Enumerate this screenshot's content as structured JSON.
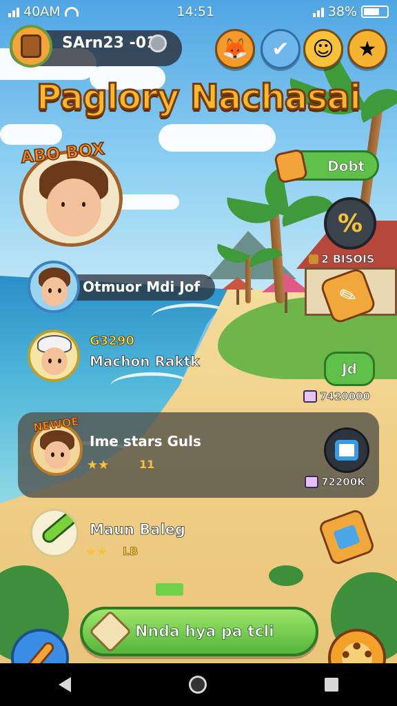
{
  "status_bar": {
    "left_text": "40AM",
    "time": "14:51",
    "battery": "38%"
  },
  "top_hud": {
    "profile_code": "SArn23 -01",
    "buttons": [
      "fox-icon",
      "check-icon",
      "face-icon",
      "star-icon"
    ]
  },
  "title": "Paglory Nachasai",
  "hero": {
    "badge": "ABO BOX"
  },
  "side_panel": {
    "dobt_label": "Dobt",
    "percent_label": "%",
    "rating_note": "2 BISOIS",
    "jd_label": "Jd",
    "coins_1": "7420000",
    "coins_2": "72200K"
  },
  "players": [
    {
      "name": "Otmuor Mdi Jof"
    },
    {
      "code": "G3290",
      "name": "Machon Raktk"
    },
    {
      "badge": "NEWOE",
      "name": "Ime stars Guls",
      "stars": "★★",
      "level": "11"
    },
    {
      "name": "Maun Baleg",
      "stars": "★★",
      "level": "LB"
    }
  ],
  "cta": {
    "label": "Nnda hya pa tcli"
  },
  "colors": {
    "accent_green": "#5fc04a",
    "accent_orange": "#f3a12a",
    "title_gold": "#f8b82a"
  }
}
